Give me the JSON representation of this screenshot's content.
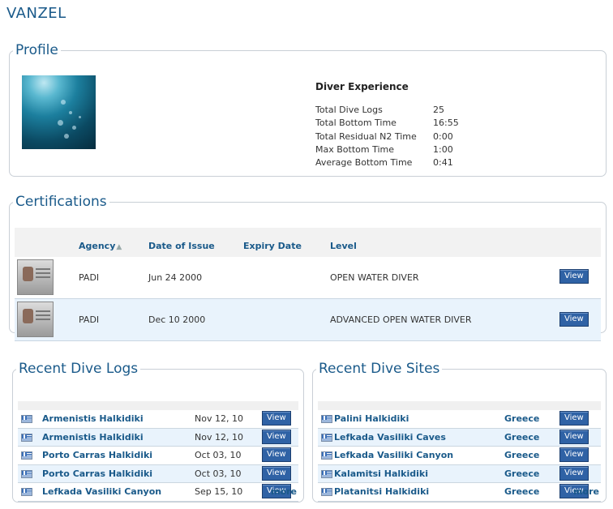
{
  "page": {
    "title": "VANZEL"
  },
  "profile": {
    "legend": "Profile",
    "experience_title": "Diver Experience",
    "stats": [
      {
        "label": "Total Dive Logs",
        "value": "25"
      },
      {
        "label": "Total Bottom Time",
        "value": "16:55"
      },
      {
        "label": "Total Residual N2 Time",
        "value": "0:00"
      },
      {
        "label": "Max Bottom Time",
        "value": "1:00"
      },
      {
        "label": "Average Bottom Time",
        "value": "0:41"
      }
    ]
  },
  "certifications": {
    "legend": "Certifications",
    "columns": {
      "agency": "Agency",
      "date_of_issue": "Date of Issue",
      "expiry_date": "Expiry Date",
      "level": "Level"
    },
    "sort_indicator": "▲",
    "rows": [
      {
        "agency": "PADI",
        "date_of_issue": "Jun 24 2000",
        "expiry_date": "",
        "level": "OPEN WATER DIVER",
        "button": "View"
      },
      {
        "agency": "PADI",
        "date_of_issue": "Dec 10 2000",
        "expiry_date": "",
        "level": "ADVANCED OPEN WATER DIVER",
        "button": "View"
      }
    ]
  },
  "recent_logs": {
    "legend": "Recent Dive Logs",
    "items": [
      {
        "name": "Armenistis Halkidiki",
        "date": "Nov 12, 10",
        "button": "View"
      },
      {
        "name": "Armenistis Halkidiki",
        "date": "Nov 12, 10",
        "button": "View"
      },
      {
        "name": "Porto Carras Halkidiki",
        "date": "Oct 03, 10",
        "button": "View"
      },
      {
        "name": "Porto Carras Halkidiki",
        "date": "Oct 03, 10",
        "button": "View"
      },
      {
        "name": "Lefkada Vasiliki Canyon",
        "date": "Sep 15, 10",
        "button": "View"
      }
    ],
    "more": "more"
  },
  "recent_sites": {
    "legend": "Recent Dive Sites",
    "items": [
      {
        "name": "Palini Halkidiki",
        "country": "Greece",
        "button": "View"
      },
      {
        "name": "Lefkada Vasiliki Caves",
        "country": "Greece",
        "button": "View"
      },
      {
        "name": "Lefkada Vasiliki Canyon",
        "country": "Greece",
        "button": "View"
      },
      {
        "name": "Kalamitsi Halkidiki",
        "country": "Greece",
        "button": "View"
      },
      {
        "name": "Platanitsi Halkidiki",
        "country": "Greece",
        "button": "View"
      }
    ],
    "more": "more"
  },
  "icons": {
    "flag": "greece-flag-icon",
    "sort": "sort-ascending-icon"
  },
  "colors": {
    "accent": "#1a5a8a",
    "button": "#2f62a5",
    "row_alt": "#e9f3fc"
  }
}
